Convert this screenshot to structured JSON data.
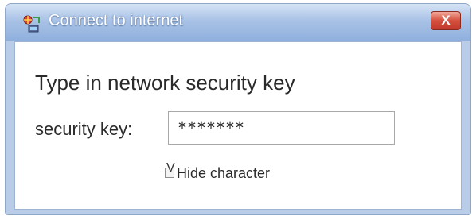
{
  "window": {
    "title": "Connect to internet",
    "close_label": "X"
  },
  "dialog": {
    "heading": "Type in network security key",
    "field_label": "security key:",
    "field_value": "*******",
    "checkbox_mark": "V",
    "checkbox_label": "Hide character",
    "checkbox_checked": true
  },
  "colors": {
    "titlebar": "#a9c2e6",
    "close_button": "#d5503d",
    "frame": "#b9cde9"
  },
  "icons": {
    "app": "network-connect-icon"
  }
}
